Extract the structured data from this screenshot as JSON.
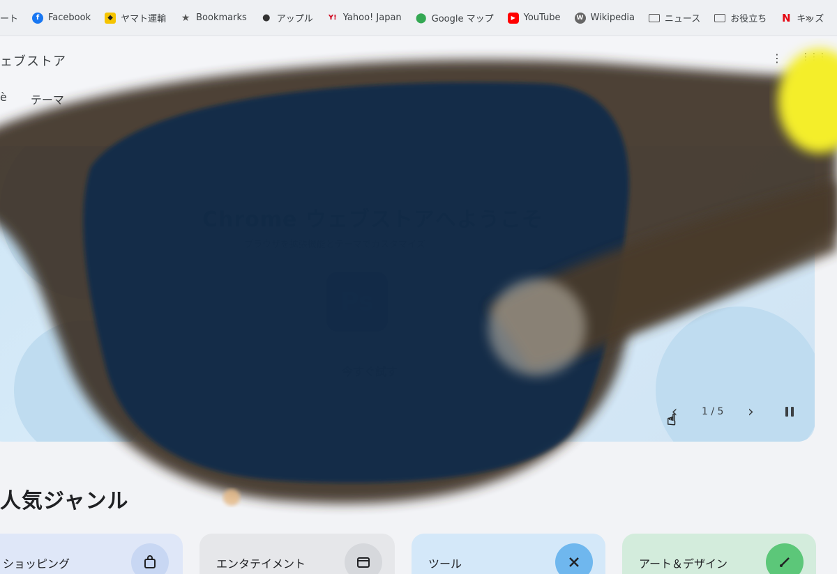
{
  "bookmarks_bar": {
    "items": [
      {
        "label": "ート",
        "icon": "folder-icon"
      },
      {
        "label": "Facebook",
        "icon": "facebook-icon"
      },
      {
        "label": "ヤマト運輸",
        "icon": "yamato-icon"
      },
      {
        "label": "Bookmarks",
        "icon": "star-icon"
      },
      {
        "label": "アップル",
        "icon": "apple-icon"
      },
      {
        "label": "Yahoo! Japan",
        "icon": "yahoo-icon"
      },
      {
        "label": "Google マップ",
        "icon": "maps-pin-icon"
      },
      {
        "label": "YouTube",
        "icon": "youtube-icon"
      },
      {
        "label": "Wikipedia",
        "icon": "wikipedia-icon"
      },
      {
        "label": "ニュース",
        "icon": "folder-icon"
      },
      {
        "label": "お役立ち",
        "icon": "folder-icon"
      },
      {
        "label": "キッズ",
        "icon": "netflix-icon"
      }
    ],
    "more": "»"
  },
  "header": {
    "title": "ェブストア",
    "nav": [
      "ѐ",
      "テーマ"
    ]
  },
  "hero": {
    "title": "Chrome ウェブストアへようこそ",
    "subtitle": "ブラウザを拡張機能とテーマでカスタマイズ",
    "apps": [
      {
        "label": "",
        "color": "#e8eef4"
      },
      {
        "label": "",
        "color": "#e8eef4"
      },
      {
        "label": "Ps",
        "color": "#1f4b7a"
      }
    ],
    "cta": "今すぐ試す",
    "carousel": {
      "prev": "‹",
      "next": "›",
      "counter": "1 / 5"
    }
  },
  "popular": {
    "title": "人気ジャンル",
    "genres": [
      {
        "label": "ショッピング",
        "icon": "shopping-bag-icon",
        "bg": "#dfe7f8",
        "icon_bg": "#c8d7f3"
      },
      {
        "label": "エンタテイメント",
        "icon": "calendar-movie-icon",
        "bg": "#e6e7ea",
        "icon_bg": "#d6d8dc"
      },
      {
        "label": "ツール",
        "icon": "tools-icon",
        "bg": "#d4e8f9",
        "icon_bg": "#6fb7ee"
      },
      {
        "label": "アート＆デザイン",
        "icon": "brush-icon",
        "bg": "#d3ecdc",
        "icon_bg": "#5cc779"
      }
    ]
  }
}
